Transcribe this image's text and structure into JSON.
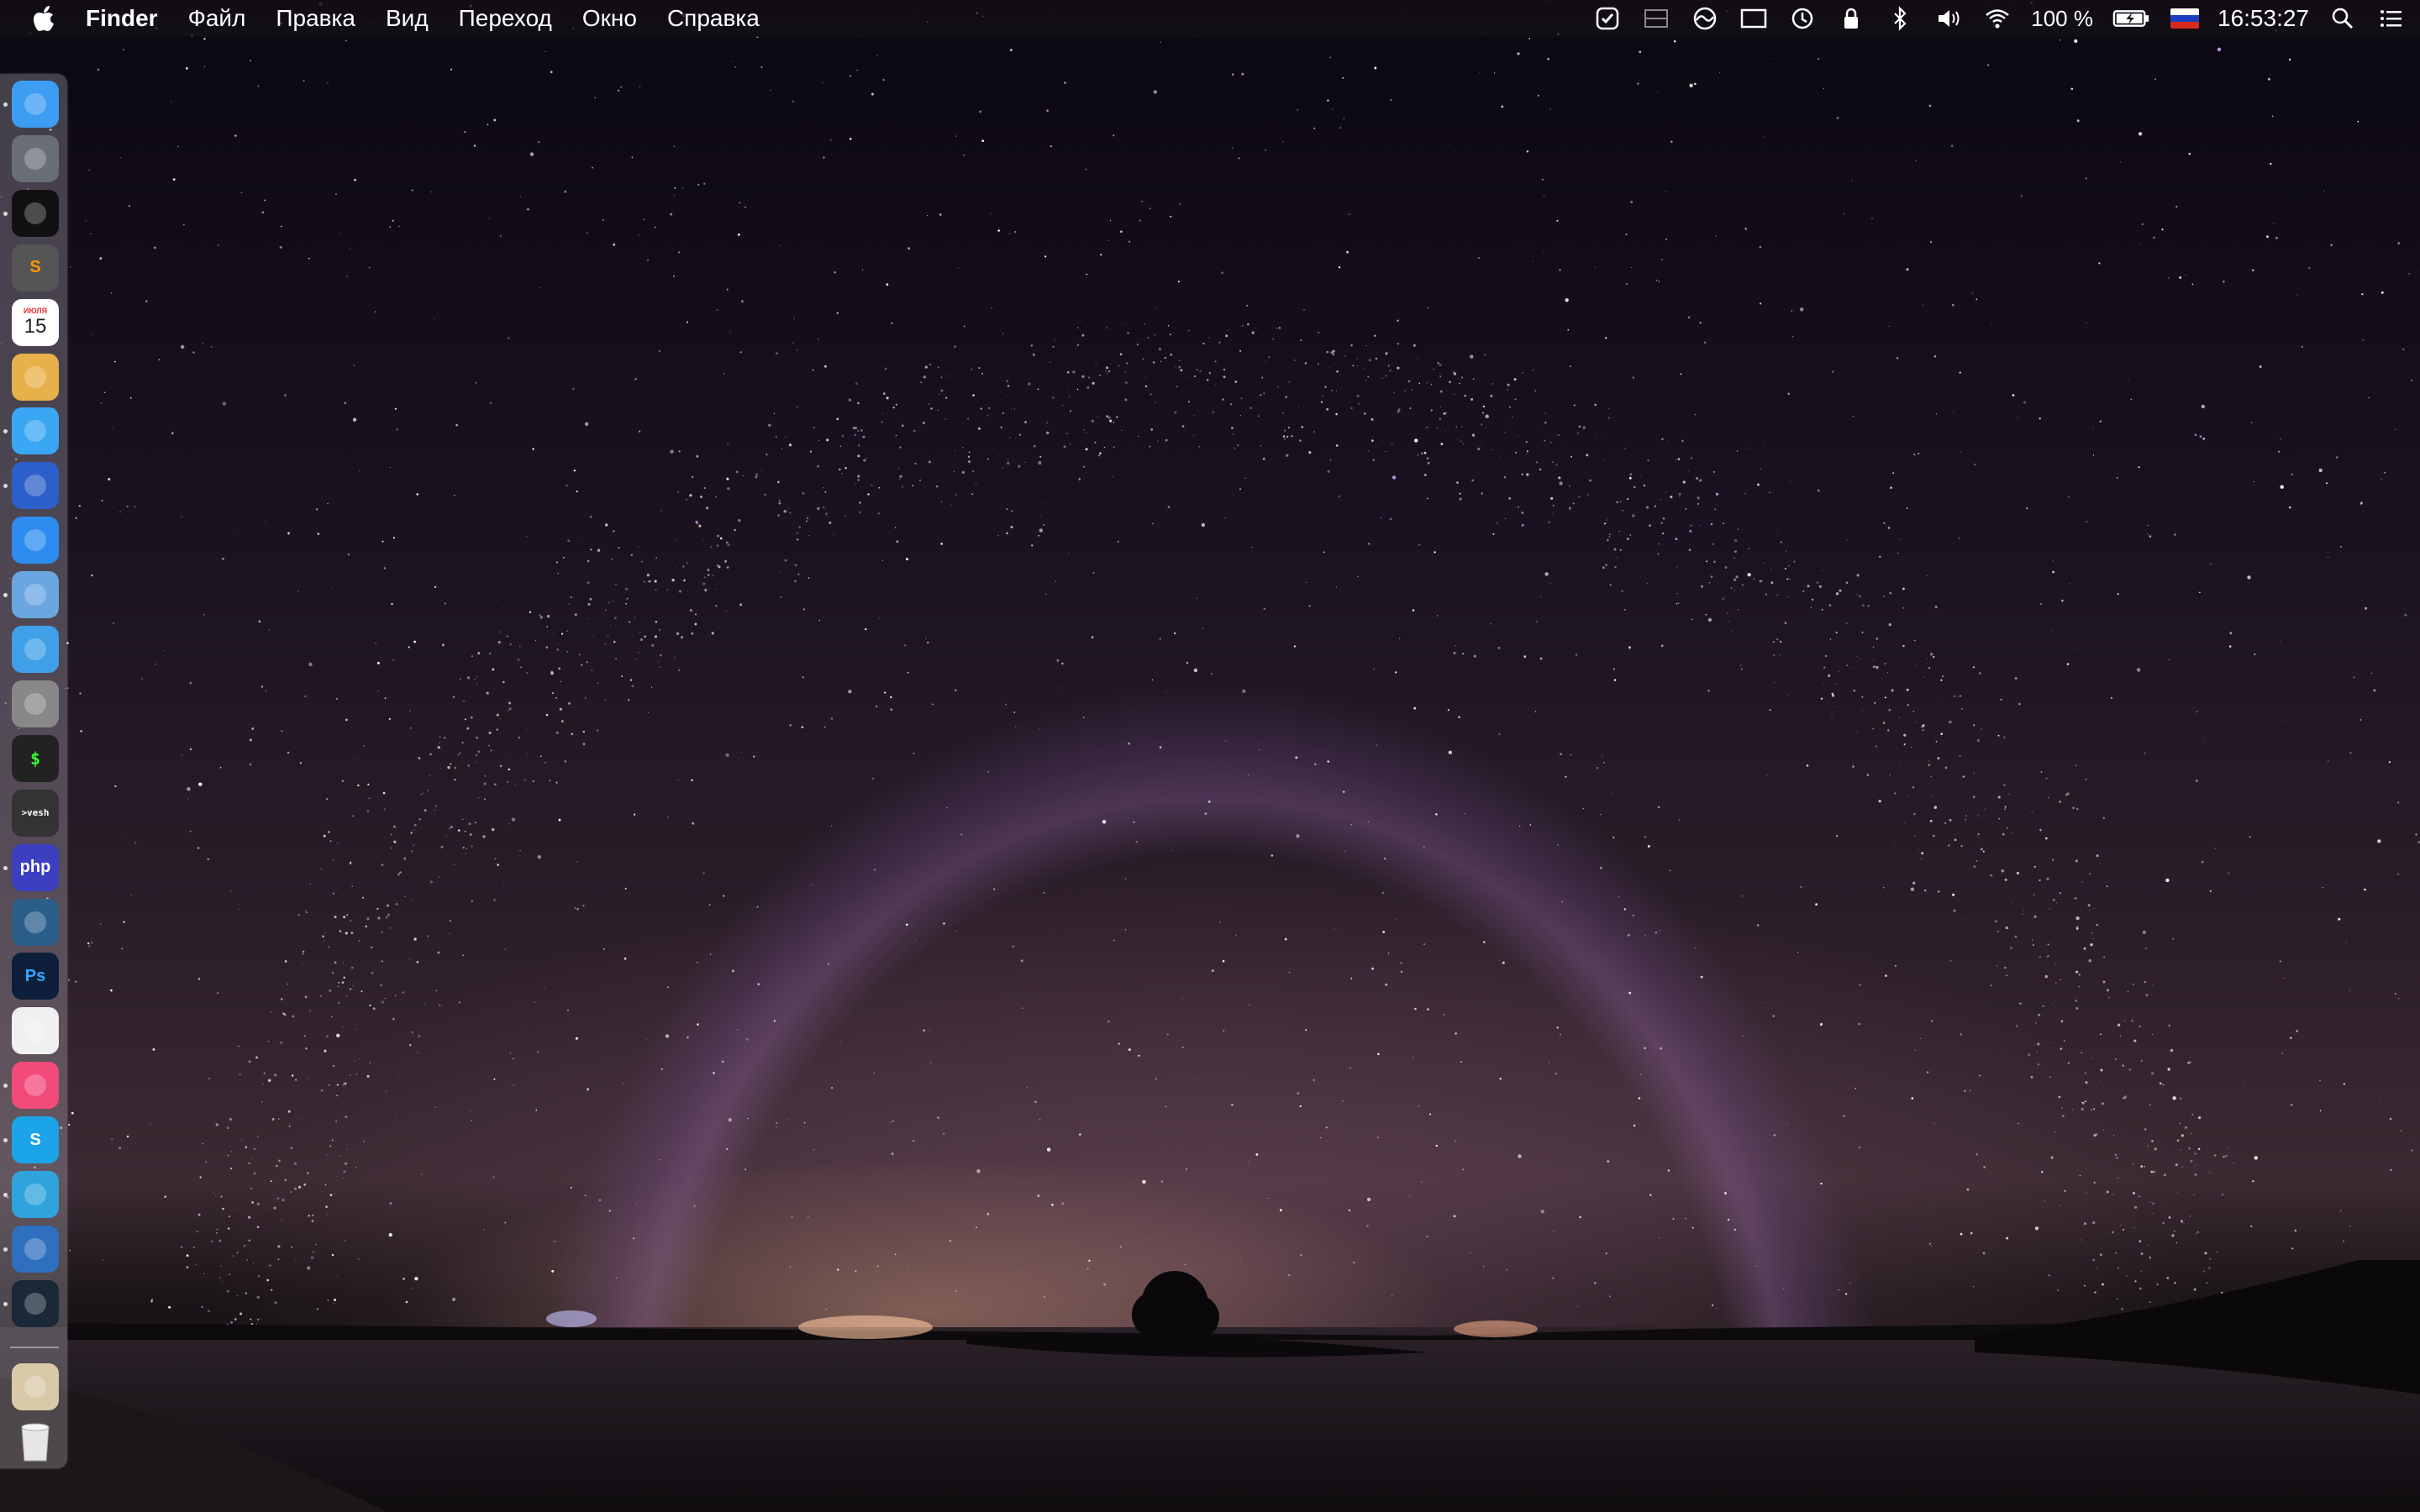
{
  "menubar": {
    "apple_icon": "apple-icon",
    "items": [
      {
        "label": "Finder",
        "bold": true
      },
      {
        "label": "Файл"
      },
      {
        "label": "Правка"
      },
      {
        "label": "Вид"
      },
      {
        "label": "Переход"
      },
      {
        "label": "Окно"
      },
      {
        "label": "Справка"
      }
    ],
    "status": {
      "battery_percent": "100 %",
      "clock": "16:53:27"
    },
    "status_icons": [
      "checkmark-icon",
      "menu-meters-icon",
      "creative-cloud-icon",
      "display-icon",
      "time-machine-icon",
      "lock-icon",
      "bluetooth-icon",
      "volume-icon",
      "wifi-icon",
      "battery-icon",
      "flag-icon",
      "spotlight-icon",
      "notification-center-icon"
    ]
  },
  "dock": {
    "items": [
      {
        "name": "finder",
        "color": "#3d9df2",
        "running": true
      },
      {
        "name": "launchpad",
        "color": "#6a6e79",
        "running": false
      },
      {
        "name": "activity-monitor",
        "color": "#111111",
        "running": true
      },
      {
        "name": "sublime-text",
        "color": "#555555",
        "running": false
      },
      {
        "name": "calendar",
        "color": "#ffffff",
        "running": false
      },
      {
        "name": "notes",
        "color": "#e8b04a",
        "running": false
      },
      {
        "name": "messages",
        "color": "#3aa7f5",
        "running": true
      },
      {
        "name": "messenger",
        "color": "#2c5fc9",
        "running": true
      },
      {
        "name": "safari",
        "color": "#2d8cf0",
        "running": false
      },
      {
        "name": "preview",
        "color": "#6aa6e0",
        "running": true
      },
      {
        "name": "virtualbox",
        "color": "#3fa0e8",
        "running": false
      },
      {
        "name": "system-preferences",
        "color": "#888888",
        "running": false
      },
      {
        "name": "terminal",
        "color": "#222222",
        "running": false
      },
      {
        "name": "vesh",
        "color": "#333333",
        "running": false
      },
      {
        "name": "phpstorm",
        "color": "#3c3fbf",
        "running": true
      },
      {
        "name": "mysql-workbench",
        "color": "#2b5f8a",
        "running": false
      },
      {
        "name": "photoshop",
        "color": "#0d1f3a",
        "running": false
      },
      {
        "name": "photos",
        "color": "#f0f0f0",
        "running": false
      },
      {
        "name": "itunes",
        "color": "#f24a7a",
        "running": true
      },
      {
        "name": "skype",
        "color": "#1ba4e8",
        "running": true
      },
      {
        "name": "telegram",
        "color": "#2fa3dc",
        "running": true
      },
      {
        "name": "adium",
        "color": "#2e6fbf",
        "running": true
      },
      {
        "name": "steam",
        "color": "#1b2838",
        "running": true
      },
      {
        "name": "downloads-stack",
        "color": "#d9c9a8",
        "running": false
      },
      {
        "name": "trash",
        "color": "#dcdcdc",
        "running": false
      }
    ],
    "calendar_day": "15",
    "calendar_month": "ИЮЛЯ",
    "terminal_glyph": "$",
    "vesh_glyph": ">vesh",
    "php_text": "php",
    "ps_text": "Ps",
    "sublime_text": "S",
    "skype_text": "S"
  }
}
